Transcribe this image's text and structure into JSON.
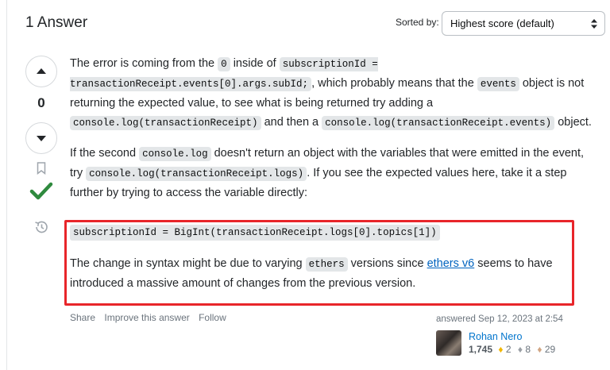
{
  "header": {
    "answers_count": "1 Answer",
    "sorted_by_label": "Sorted by:",
    "sort_selected": "Highest score (default)"
  },
  "votes": {
    "score": "0"
  },
  "answer": {
    "p1_a": "The error is coming from the ",
    "p1_code1": "0",
    "p1_b": " inside of ",
    "p1_code2": "subscriptionId = transactionReceipt.events[0].args.subId;",
    "p1_c": ", which probably means that the ",
    "p1_code3": "events",
    "p1_d": " object is not returning the expected value, to see what is being returned try adding a ",
    "p1_code4": "console.log(transactionReceipt)",
    "p1_e": " and then a ",
    "p1_code5": "console.log(transactionReceipt.events)",
    "p1_f": " object.",
    "p2_a": "If the second ",
    "p2_code1": "console.log",
    "p2_b": " doesn't return an object with the variables that were emitted in the event, try ",
    "p2_code2": "console.log(transactionReceipt.logs)",
    "p2_c": ". If you see the expected values here, take it a step further by trying to access the variable directly:",
    "code_block": "subscriptionId = BigInt(transactionReceipt.logs[0].topics[1])",
    "p3_a": "The change in syntax might be due to varying ",
    "p3_code1": "ethers",
    "p3_b": " versions since ",
    "p3_link": "ethers v6",
    "p3_c": " seems to have introduced a massive amount of changes from the previous version."
  },
  "post_menu": {
    "share": "Share",
    "improve": "Improve this answer",
    "follow": "Follow"
  },
  "user": {
    "answered": "answered Sep 12, 2023 at 2:54",
    "name": "Rohan Nero",
    "reputation": "1,745",
    "gold": "2",
    "silver": "8",
    "bronze": "29"
  },
  "colors": {
    "accepted": "#2f8a3e",
    "highlight_border": "#e8252a",
    "link": "#0063bf"
  },
  "icons": [
    "chevron-up-down-icon",
    "vote-up-icon",
    "vote-down-icon",
    "bookmark-icon",
    "accepted-check-icon",
    "history-icon"
  ]
}
